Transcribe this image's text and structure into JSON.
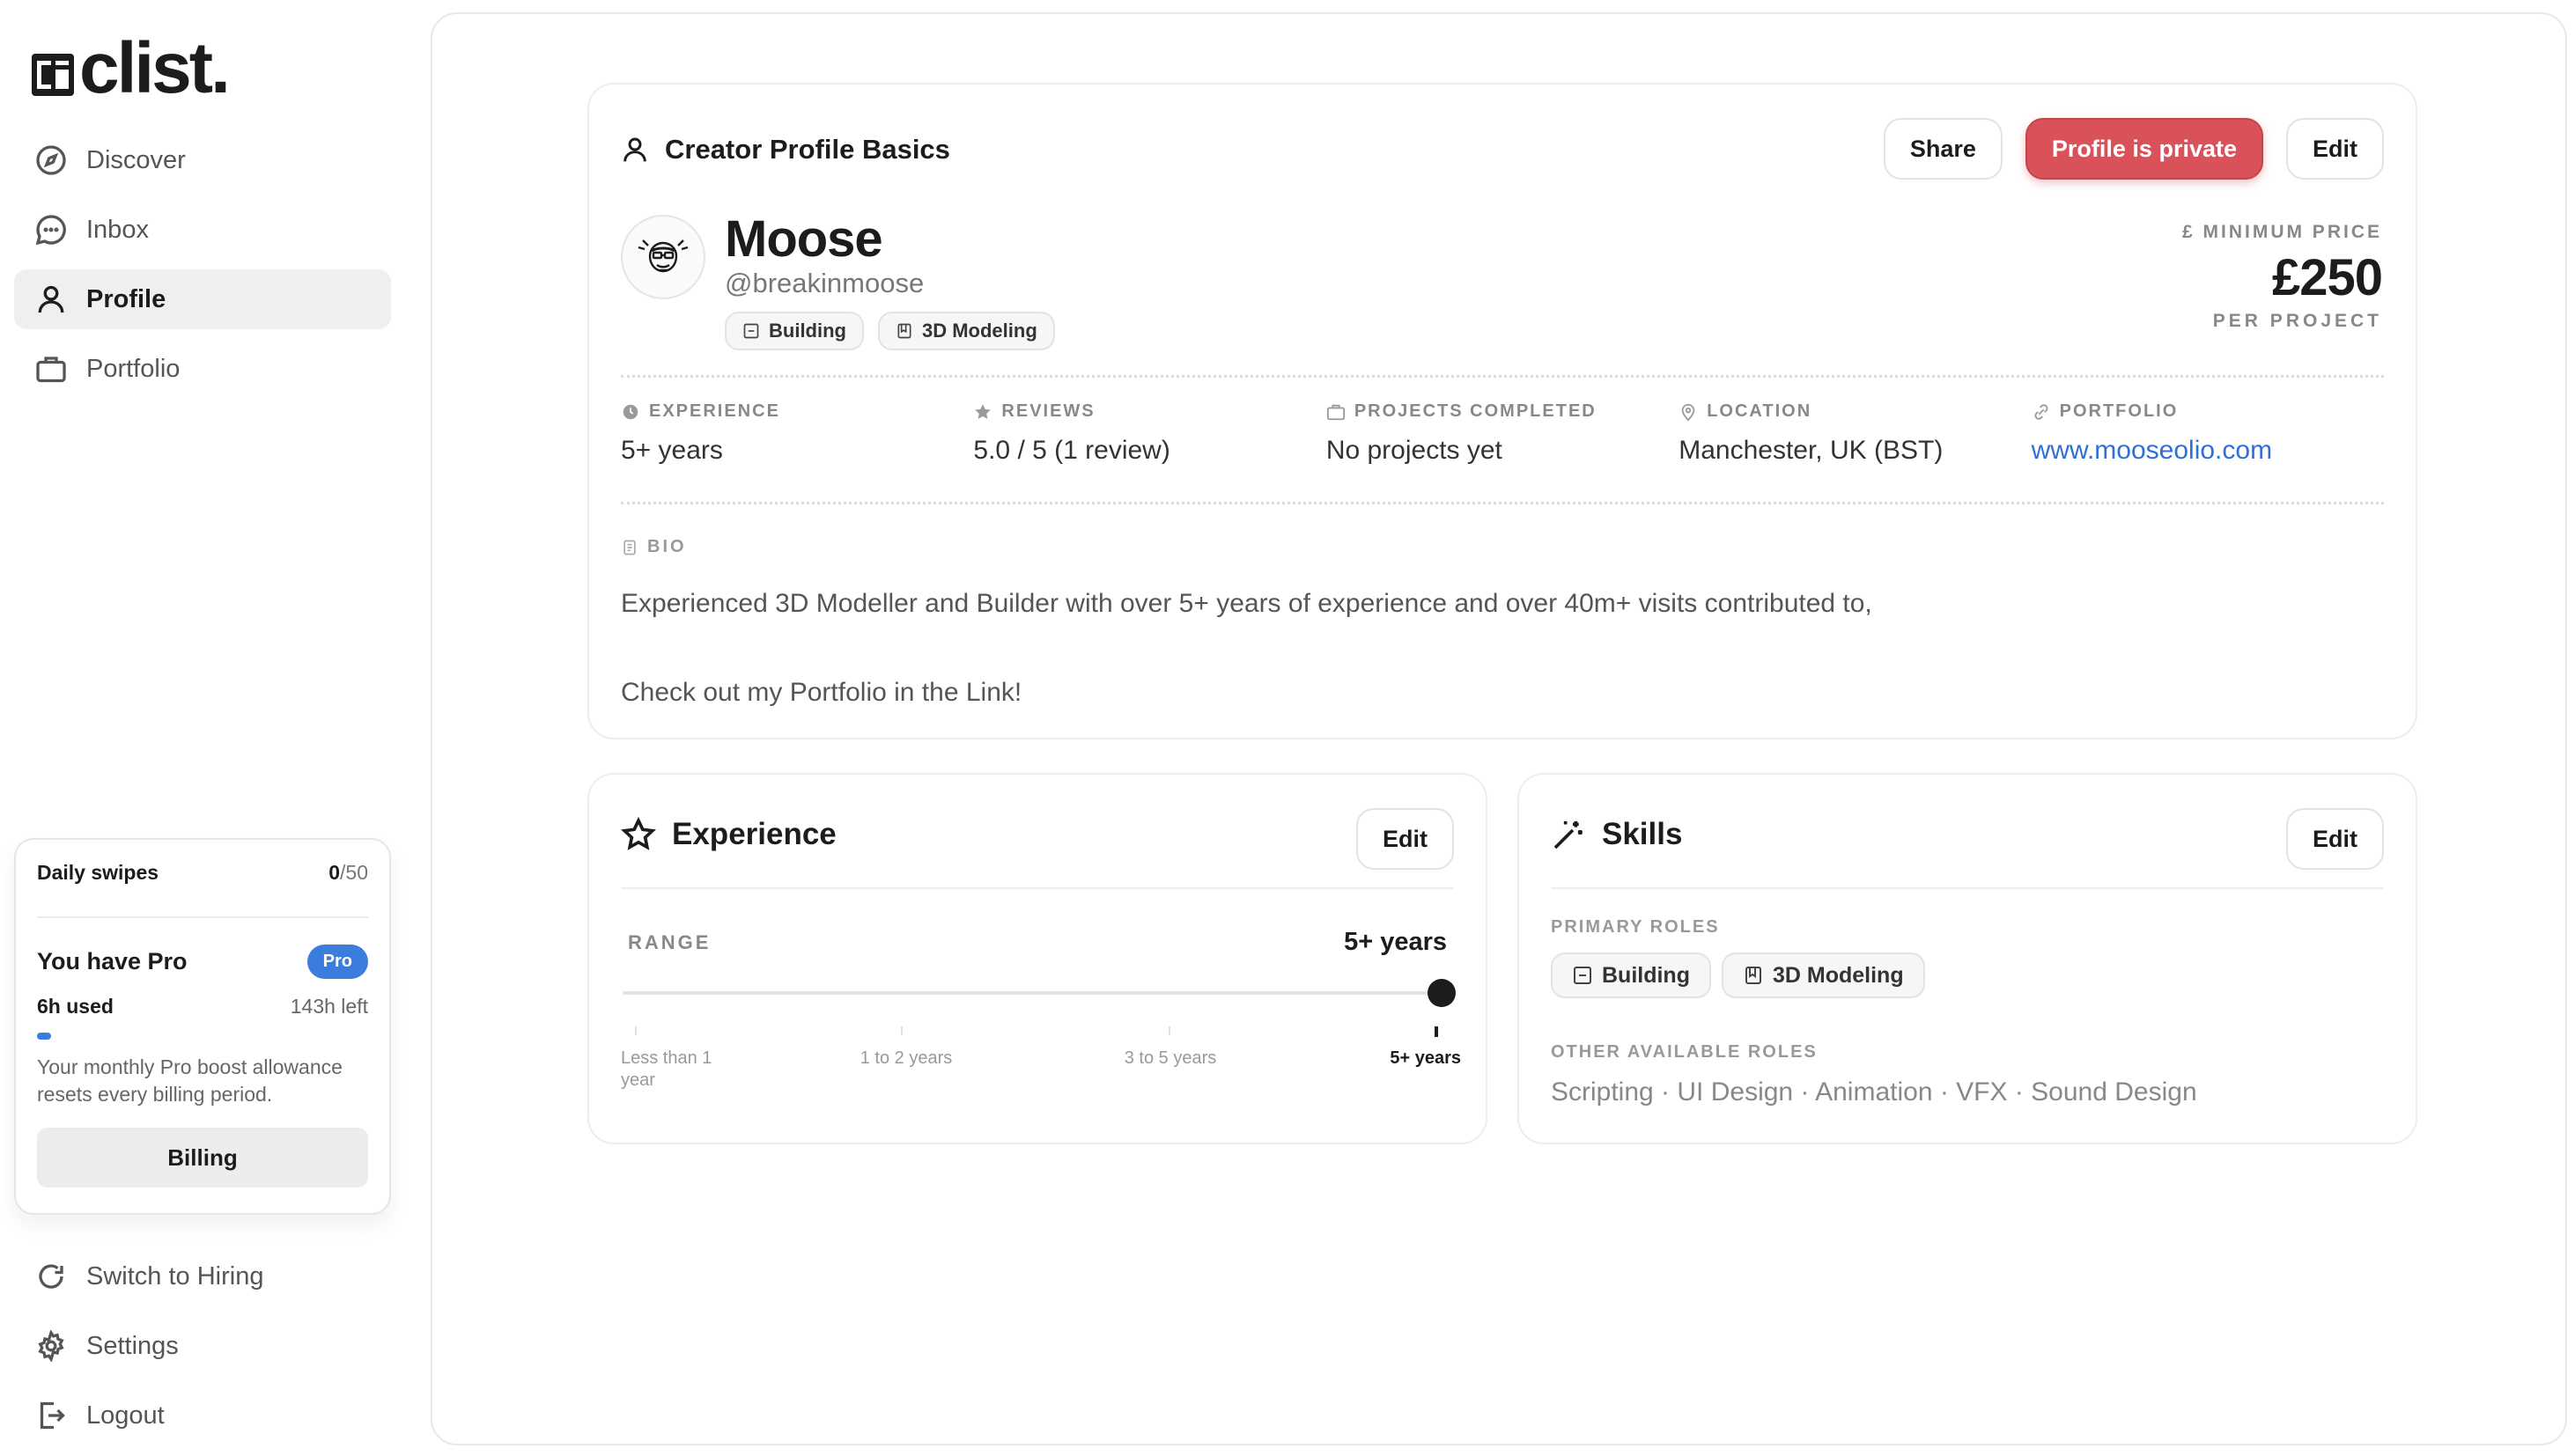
{
  "app": {
    "logo_text": "clist."
  },
  "sidebar": {
    "items": [
      {
        "label": "Discover",
        "icon": "compass-icon"
      },
      {
        "label": "Inbox",
        "icon": "chat-icon"
      },
      {
        "label": "Profile",
        "icon": "user-icon",
        "active": true
      },
      {
        "label": "Portfolio",
        "icon": "briefcase-icon"
      }
    ],
    "bottom_items": [
      {
        "label": "Switch to Hiring",
        "icon": "refresh-icon"
      },
      {
        "label": "Settings",
        "icon": "gear-icon"
      },
      {
        "label": "Logout",
        "icon": "logout-icon"
      }
    ]
  },
  "usage": {
    "daily_swipes_label": "Daily swipes",
    "daily_swipes_used": "0",
    "daily_swipes_total": "/50",
    "pro_title": "You have Pro",
    "pro_badge": "Pro",
    "hours_used": "6h used",
    "hours_left": "143h left",
    "hours_used_fraction": 0.04,
    "note": "Your monthly Pro boost allowance resets every billing period.",
    "billing_label": "Billing"
  },
  "profile": {
    "section_title": "Creator Profile Basics",
    "share_label": "Share",
    "privacy_label": "Profile is private",
    "edit_label": "Edit",
    "name": "Moose",
    "handle": "@breakinmoose",
    "tags": [
      "Building",
      "3D Modeling"
    ],
    "price_label": "£  MINIMUM PRICE",
    "price_value": "£250",
    "price_sub": "PER PROJECT",
    "stats": [
      {
        "label": "EXPERIENCE",
        "value": "5+ years",
        "icon": "clock-icon"
      },
      {
        "label": "REVIEWS",
        "value": "5.0 / 5 (1 review)",
        "icon": "star-icon"
      },
      {
        "label": "PROJECTS COMPLETED",
        "value": "No projects yet",
        "icon": "briefcase-icon"
      },
      {
        "label": "LOCATION",
        "value": "Manchester, UK (BST)",
        "icon": "pin-icon"
      },
      {
        "label": "PORTFOLIO",
        "value": "www.mooseolio.com",
        "icon": "link-icon"
      }
    ],
    "bio_label": "BIO",
    "bio_lines": [
      "Experienced 3D Modeller and Builder with over 5+ years of experience and over 40m+ visits contributed to,",
      "Check out my Portfolio in the Link!"
    ],
    "accent_color": "#d9525a",
    "link_color": "#2f6fd8"
  },
  "experience": {
    "title": "Experience",
    "edit_label": "Edit",
    "range_label": "RANGE",
    "range_value": "5+ years",
    "range_index": 3,
    "ticks": [
      "Less than 1 year",
      "1 to 2 years",
      "3 to 5 years",
      "5+ years"
    ]
  },
  "skills": {
    "title": "Skills",
    "edit_label": "Edit",
    "primary_label": "PRIMARY ROLES",
    "primary_roles": [
      "Building",
      "3D Modeling"
    ],
    "other_label": "OTHER AVAILABLE ROLES",
    "other_roles": "Scripting · UI Design · Animation · VFX · Sound Design"
  }
}
